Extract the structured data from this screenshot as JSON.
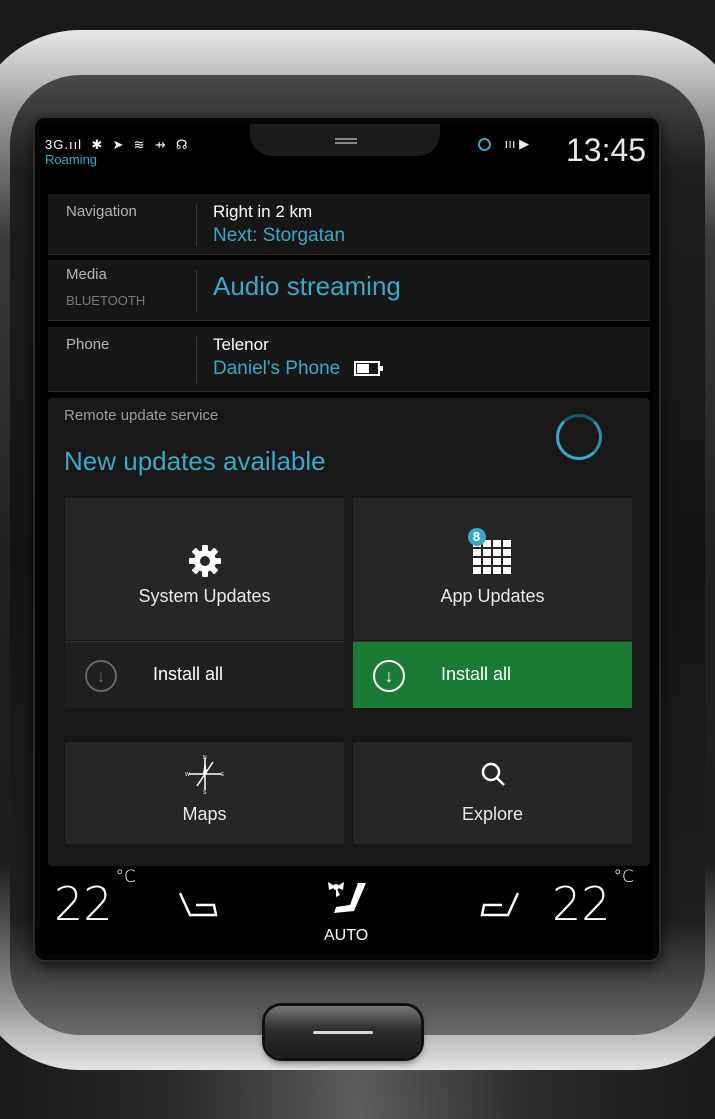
{
  "status_bar": {
    "signal_text": "3G.ııl",
    "roaming": "Roaming",
    "right_icons": "ııı ▶",
    "time": "13:45"
  },
  "tiles": {
    "navigation": {
      "label": "Navigation",
      "line1": "Right in 2 km",
      "line2": "Next: Storgatan"
    },
    "media": {
      "label": "Media",
      "sublabel": "BLUETOOTH",
      "line2": "Audio streaming"
    },
    "phone": {
      "label": "Phone",
      "line1": "Telenor",
      "line2": "Daniel's Phone"
    }
  },
  "remote_update": {
    "title": "Remote update service",
    "headline": "New updates available",
    "system_updates": {
      "label": "System Updates",
      "install_label": "Install all"
    },
    "app_updates": {
      "label": "App Updates",
      "badge": "8",
      "install_label": "Install all"
    }
  },
  "apps": {
    "maps": {
      "label": "Maps"
    },
    "explore": {
      "label": "Explore"
    }
  },
  "climate": {
    "left_temp": "22",
    "right_temp": "22",
    "unit": "°C",
    "auto_label": "AUTO"
  },
  "colors": {
    "accent": "#3aa7c9",
    "install_active": "#1b7a36"
  }
}
